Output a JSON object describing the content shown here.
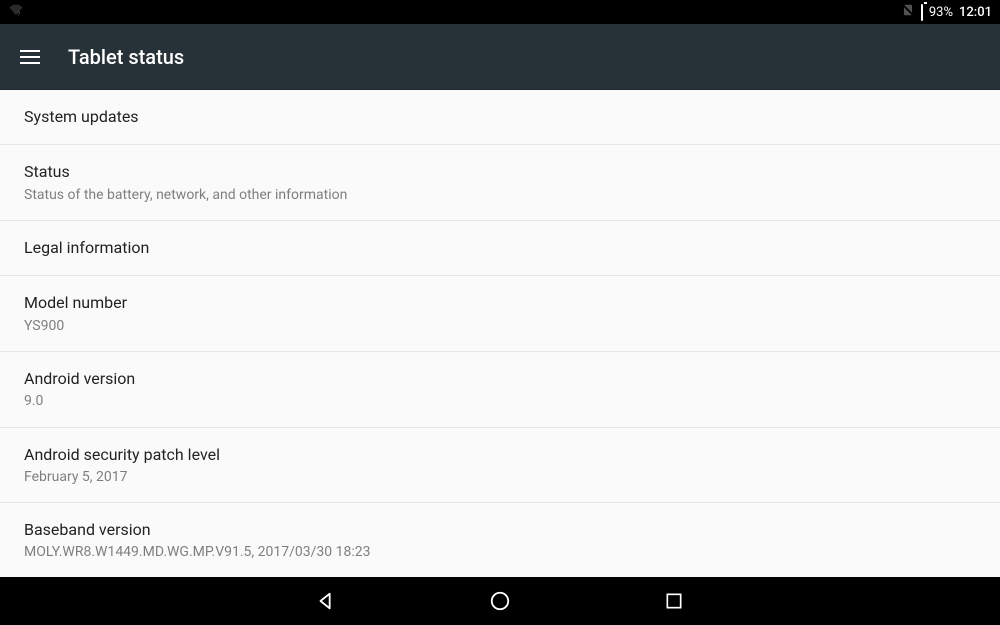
{
  "statusbar": {
    "battery": "93%",
    "time": "12:01"
  },
  "appbar": {
    "title": "Tablet status"
  },
  "items": [
    {
      "title": "System updates",
      "subtitle": ""
    },
    {
      "title": "Status",
      "subtitle": "Status of the battery, network, and other information"
    },
    {
      "title": "Legal information",
      "subtitle": ""
    },
    {
      "title": "Model number",
      "subtitle": "YS900"
    },
    {
      "title": "Android version",
      "subtitle": "9.0"
    },
    {
      "title": "Android security patch level",
      "subtitle": "February 5, 2017"
    },
    {
      "title": "Baseband version",
      "subtitle": "MOLY.WR8.W1449.MD.WG.MP.V91.5, 2017/03/30 18:23"
    }
  ]
}
